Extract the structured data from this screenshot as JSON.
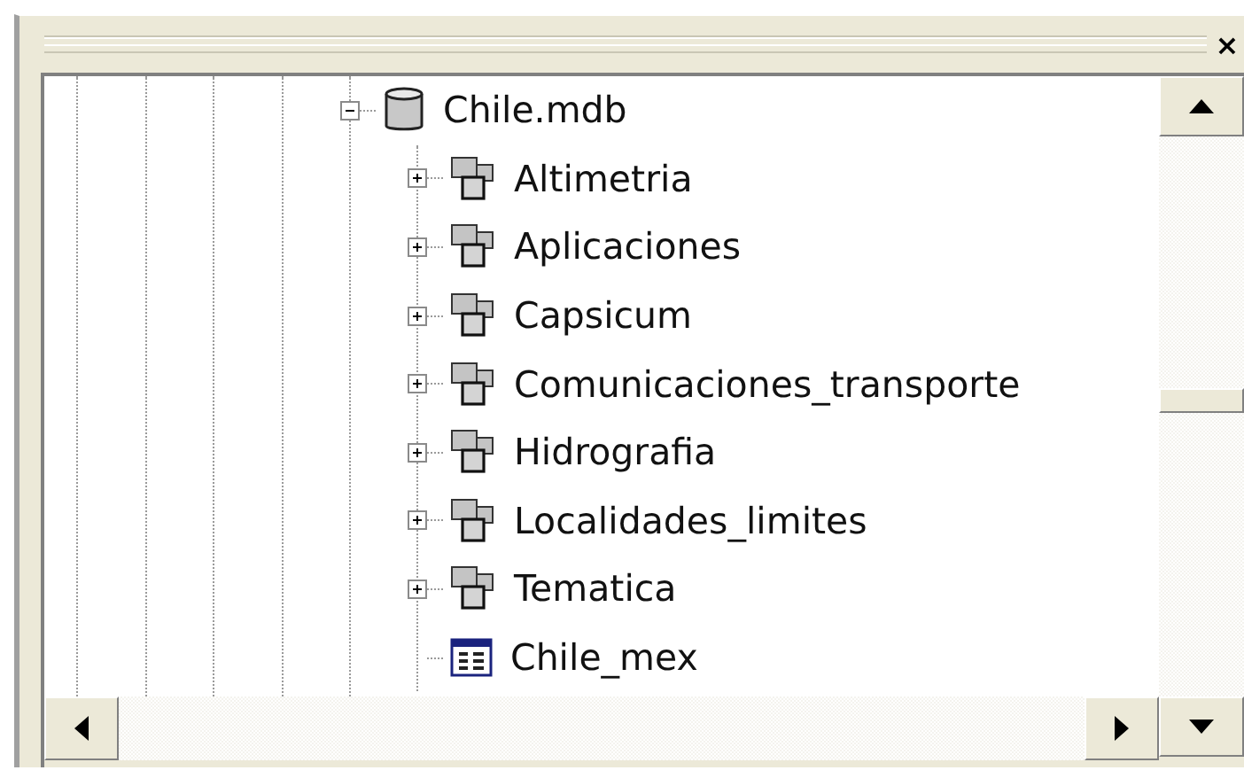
{
  "panel": {
    "close_label": "×"
  },
  "tree": {
    "label": "Chile.mdb",
    "kind": "database",
    "expanded": true,
    "children": [
      {
        "label": "Altimetria",
        "kind": "dataset",
        "expanded": false
      },
      {
        "label": "Aplicaciones",
        "kind": "dataset",
        "expanded": false
      },
      {
        "label": "Capsicum",
        "kind": "dataset",
        "expanded": false
      },
      {
        "label": "Comunicaciones_transporte",
        "kind": "dataset",
        "expanded": false
      },
      {
        "label": "Hidrografia",
        "kind": "dataset",
        "expanded": false
      },
      {
        "label": "Localidades_limites",
        "kind": "dataset",
        "expanded": false
      },
      {
        "label": "Tematica",
        "kind": "dataset",
        "expanded": false
      },
      {
        "label": "Chile_mex",
        "kind": "table"
      }
    ]
  }
}
